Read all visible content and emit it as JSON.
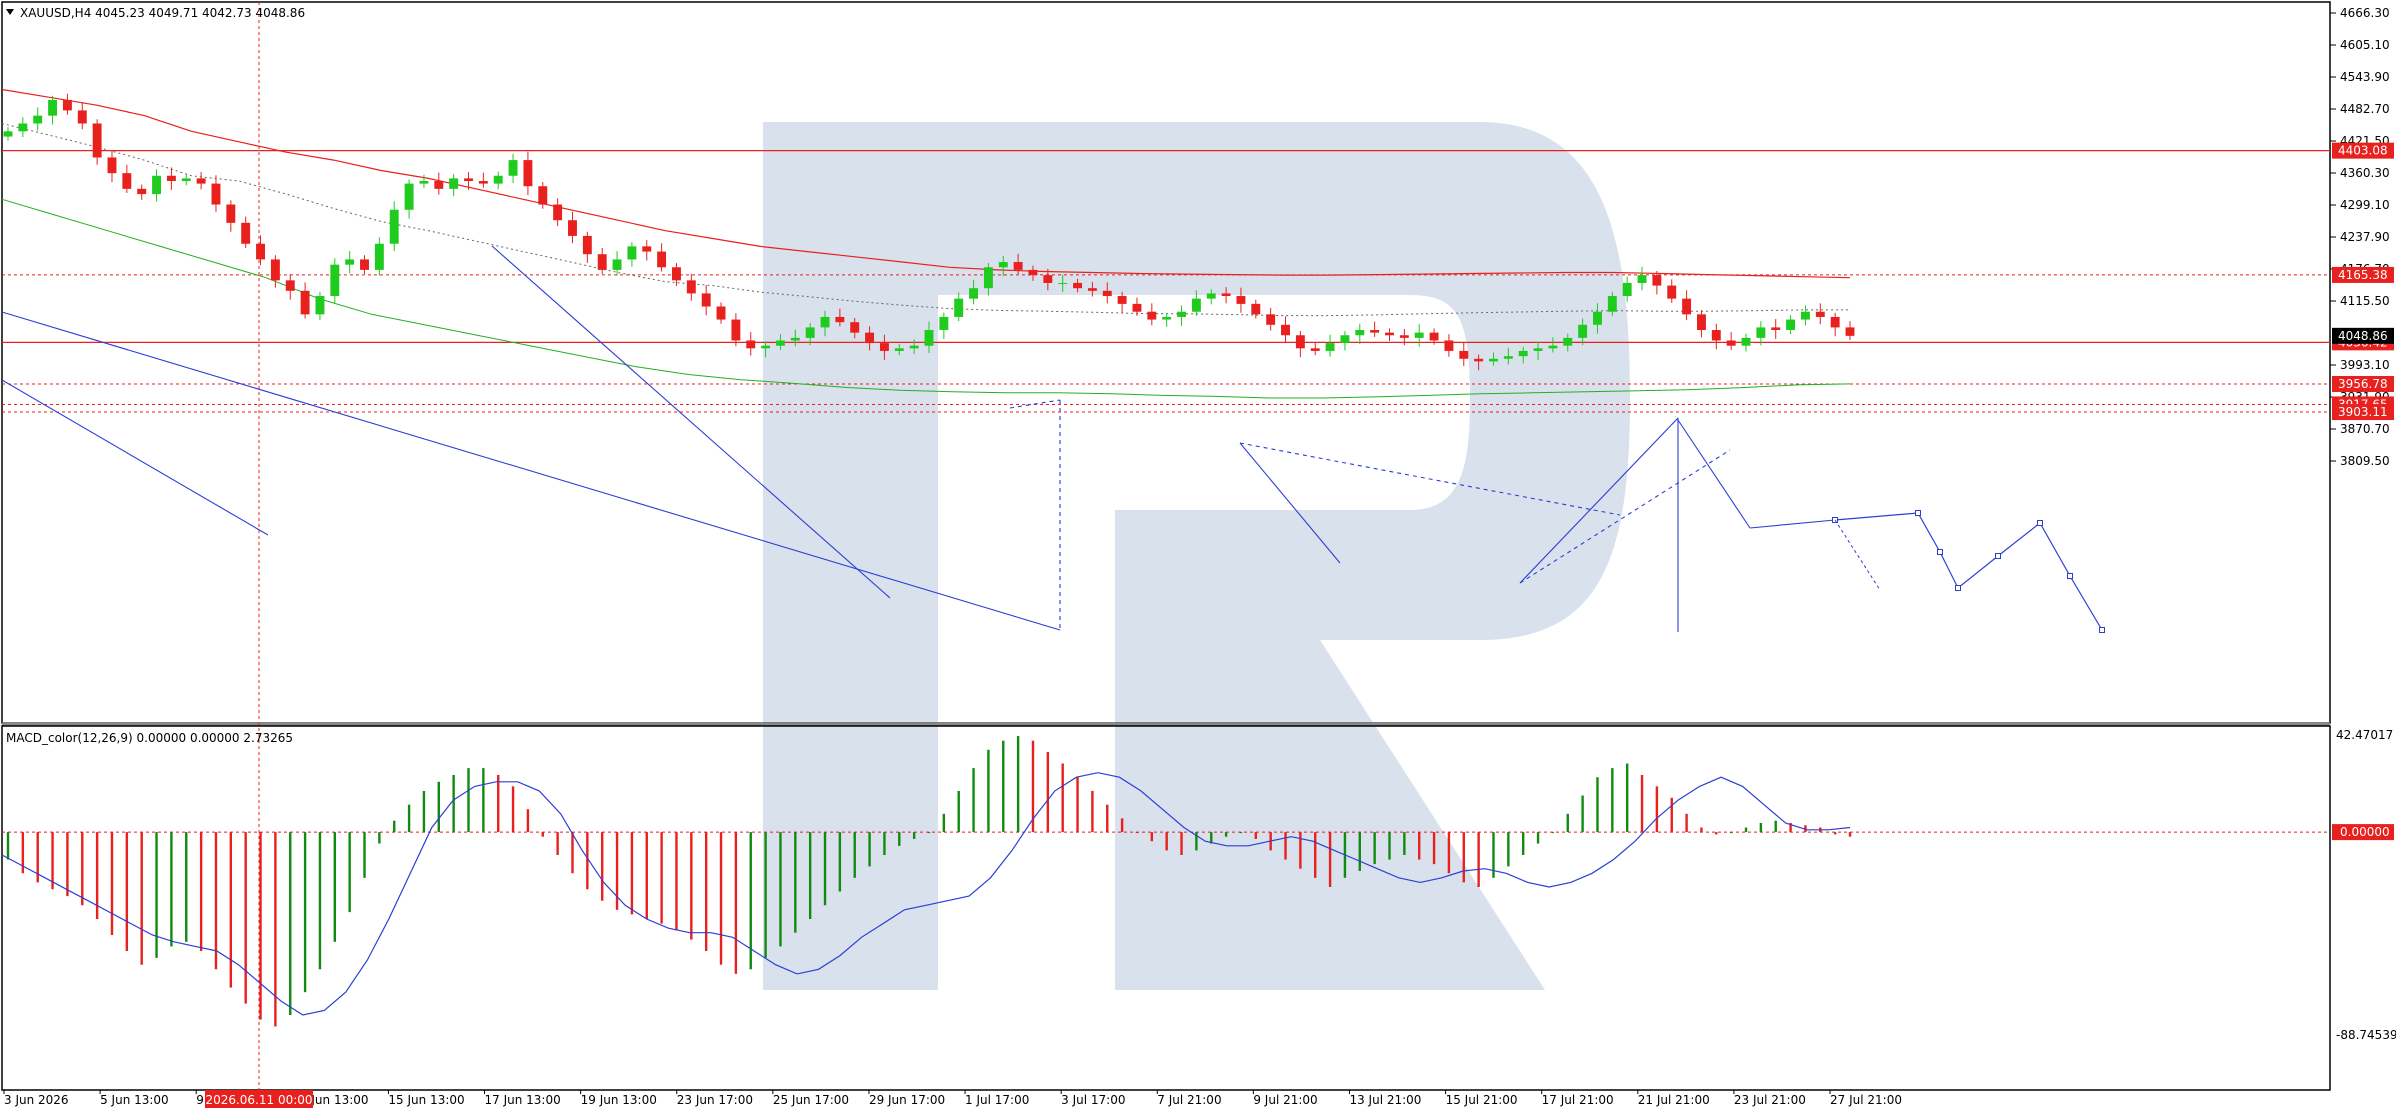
{
  "chart_data": [
    {
      "type": "candlestick",
      "symbol_header": "XAUUSD,H4  4045.23 4049.71 4042.73 4048.86",
      "ylim": [
        3780.0,
        4690.0
      ],
      "price_ticks": [
        "4666.30",
        "4605.10",
        "4543.90",
        "4482.70",
        "4421.50",
        "4360.30",
        "4299.10",
        "4237.90",
        "4176.70",
        "4115.50",
        "3993.10",
        "3931.90",
        "3870.70",
        "3809.50"
      ],
      "highlighted_levels": [
        {
          "value": "4403.08",
          "price": 4403.08,
          "style": "solid",
          "color": "#e8201e"
        },
        {
          "value": "4165.38",
          "price": 4165.38,
          "style": "dashed",
          "color": "#e8201e"
        },
        {
          "value": "4036.42",
          "price": 4036.42,
          "style": "solid",
          "color": "#e8201e"
        },
        {
          "value": "3956.78",
          "price": 3956.78,
          "style": "dashed",
          "color": "#e8201e"
        },
        {
          "value": "3917.65",
          "price": 3917.65,
          "style": "dashed",
          "color": "#e8201e"
        },
        {
          "value": "3903.11",
          "price": 3903.11,
          "style": "dashed",
          "color": "#e8201e"
        }
      ],
      "current_price_label": "4048.86",
      "current_price": 4048.86,
      "x_tick_labels": [
        "3 Jun 2026",
        "5 Jun 13:00",
        "9",
        "11 Jun 13:00",
        "15 Jun 13:00",
        "17 Jun 13:00",
        "19 Jun 13:00",
        "23 Jun 17:00",
        "25 Jun 17:00",
        "29 Jun 17:00",
        "1 Jul 17:00",
        "3 Jul 17:00",
        "7 Jul 21:00",
        "9 Jul 21:00",
        "13 Jul 21:00",
        "15 Jul 21:00",
        "17 Jul 21:00",
        "21 Jul 21:00",
        "23 Jul 21:00",
        "27 Jul 21:00"
      ],
      "crosshair_time_label": "2026.06.11 00:00",
      "close_series": [
        4440,
        4455,
        4470,
        4500,
        4480,
        4455,
        4390,
        4360,
        4330,
        4320,
        4355,
        4345,
        4350,
        4340,
        4300,
        4265,
        4225,
        4195,
        4155,
        4135,
        4090,
        4125,
        4185,
        4195,
        4175,
        4225,
        4290,
        4340,
        4345,
        4330,
        4350,
        4345,
        4340,
        4355,
        4385,
        4335,
        4300,
        4270,
        4240,
        4205,
        4175,
        4195,
        4220,
        4210,
        4180,
        4155,
        4130,
        4105,
        4080,
        4040,
        4025,
        4030,
        4040,
        4045,
        4065,
        4085,
        4075,
        4055,
        4035,
        4020,
        4025,
        4030,
        4060,
        4085,
        4120,
        4140,
        4180,
        4190,
        4175,
        4165,
        4150,
        4150,
        4140,
        4135,
        4125,
        4110,
        4095,
        4080,
        4085,
        4095,
        4120,
        4130,
        4125,
        4110,
        4090,
        4070,
        4050,
        4025,
        4020,
        4035,
        4050,
        4060,
        4055,
        4050,
        4045,
        4055,
        4040,
        4020,
        4005,
        4000,
        4005,
        4010,
        4020,
        4025,
        4030,
        4045,
        4070,
        4095,
        4125,
        4150,
        4165,
        4145,
        4120,
        4090,
        4060,
        4040,
        4030,
        4045,
        4065,
        4060,
        4080,
        4095,
        4085,
        4065,
        4048.86
      ],
      "overlays": {
        "ma_red": [
          4520,
          4505,
          4490,
          4470,
          4440,
          4420,
          4400,
          4385,
          4365,
          4350,
          4330,
          4310,
          4290,
          4270,
          4250,
          4235,
          4220,
          4210,
          4200,
          4190,
          4180,
          4175,
          4172,
          4170,
          4168,
          4167,
          4166,
          4165,
          4165,
          4166,
          4167,
          4168,
          4169,
          4170,
          4170,
          4168,
          4166,
          4164,
          4162,
          4160
        ],
        "ma_green": [
          4310,
          4280,
          4250,
          4220,
          4190,
          4160,
          4120,
          4090,
          4070,
          4050,
          4030,
          4010,
          3990,
          3975,
          3965,
          3958,
          3950,
          3945,
          3942,
          3940,
          3940,
          3938,
          3935,
          3933,
          3930,
          3930,
          3932,
          3935,
          3938,
          3940,
          3942,
          3944,
          3946,
          3950,
          3955,
          3957
        ]
      }
    },
    {
      "type": "macd",
      "label": "MACD_color(12,26,9) 0.00000 0.00000 2.73265",
      "ylim": [
        -88.74539,
        42.47017
      ],
      "tick_labels": [
        "42.47017",
        "0.00000",
        "-88.74539"
      ],
      "histogram": [
        -12,
        -18,
        -22,
        -25,
        -28,
        -32,
        -38,
        -45,
        -52,
        -58,
        -55,
        -50,
        -48,
        -52,
        -60,
        -68,
        -75,
        -82,
        -85,
        -80,
        -70,
        -60,
        -48,
        -35,
        -20,
        -5,
        5,
        12,
        18,
        22,
        25,
        28,
        28,
        25,
        20,
        10,
        -2,
        -10,
        -18,
        -25,
        -30,
        -34,
        -36,
        -38,
        -40,
        -43,
        -47,
        -52,
        -58,
        -62,
        -60,
        -55,
        -50,
        -44,
        -38,
        -32,
        -26,
        -20,
        -15,
        -10,
        -6,
        -3,
        0,
        8,
        18,
        28,
        36,
        40,
        42,
        40,
        35,
        30,
        24,
        18,
        12,
        6,
        0,
        -4,
        -8,
        -10,
        -8,
        -5,
        -2,
        0,
        -3,
        -8,
        -12,
        -16,
        -20,
        -24,
        -20,
        -17,
        -14,
        -12,
        -10,
        -12,
        -14,
        -18,
        -22,
        -24,
        -20,
        -15,
        -10,
        -5,
        0,
        8,
        16,
        24,
        28,
        30,
        25,
        20,
        15,
        8,
        2,
        -1,
        0,
        2,
        4,
        5,
        4,
        3,
        2,
        -1,
        -2
      ],
      "signal": [
        -10,
        -15,
        -20,
        -25,
        -30,
        -35,
        -40,
        -45,
        -48,
        -50,
        -52,
        -58,
        -66,
        -74,
        -80,
        -78,
        -70,
        -56,
        -38,
        -18,
        2,
        14,
        20,
        22,
        22,
        18,
        8,
        -8,
        -22,
        -32,
        -38,
        -42,
        -44,
        -44,
        -46,
        -52,
        -58,
        -62,
        -60,
        -54,
        -46,
        -40,
        -34,
        -32,
        -30,
        -28,
        -20,
        -8,
        6,
        18,
        24,
        26,
        24,
        18,
        10,
        2,
        -4,
        -6,
        -6,
        -4,
        -2,
        -4,
        -8,
        -12,
        -16,
        -20,
        -22,
        -20,
        -17,
        -16,
        -18,
        -22,
        -24,
        -22,
        -18,
        -12,
        -4,
        6,
        14,
        20,
        24,
        20,
        12,
        4,
        1,
        1,
        2
      ]
    }
  ]
}
